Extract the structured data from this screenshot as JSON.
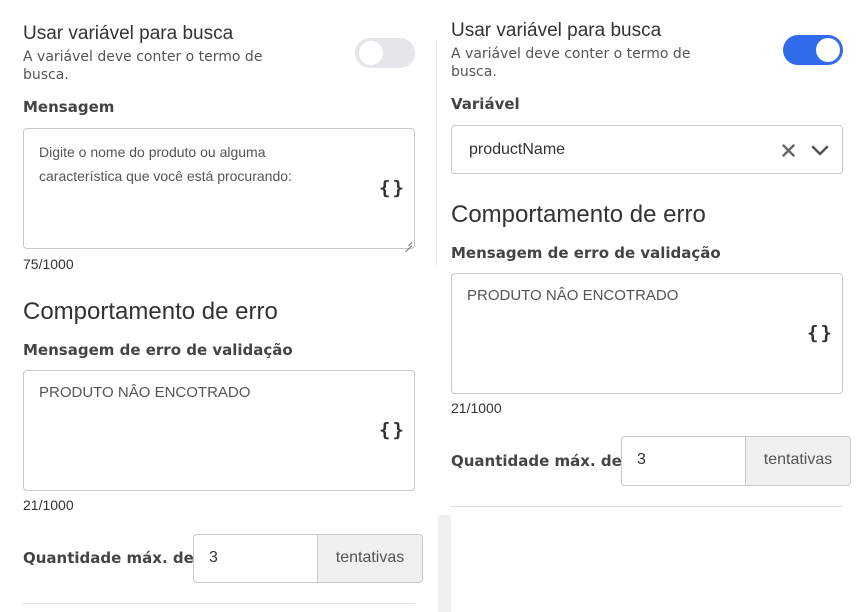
{
  "left": {
    "toggle": {
      "title": "Usar variável para busca",
      "description": "A variável deve conter o termo de busca.",
      "state": "off"
    },
    "message": {
      "label": "Mensagem",
      "value": "Digite o nome do produto ou alguma característica que você está procurando:",
      "counter": "75/1000",
      "icon": "curly-braces-icon"
    },
    "error": {
      "title": "Comportamento de erro",
      "label": "Mensagem de erro de validação",
      "value": "PRODUTO NÂO ENCOTRADO",
      "counter": "21/1000",
      "icon": "curly-braces-icon"
    },
    "quantity": {
      "label": "Quantidade máx. de:",
      "value": "3",
      "suffix": "tentativas"
    }
  },
  "right": {
    "toggle": {
      "title": "Usar variável para busca",
      "description": "A variável deve conter o termo de busca.",
      "state": "on"
    },
    "variable": {
      "label": "Variável",
      "value": "productName",
      "clear_icon": "close-icon",
      "dropdown_icon": "chevron-down-icon"
    },
    "error": {
      "title": "Comportamento de erro",
      "label": "Mensagem de erro de validação",
      "value": "PRODUTO NÂO ENCOTRADO",
      "counter": "21/1000",
      "icon": "curly-braces-icon"
    },
    "quantity": {
      "label": "Quantidade máx. de:",
      "value": "3",
      "suffix": "tentativas"
    }
  },
  "colors": {
    "toggle_on": "#2f6bea",
    "toggle_off": "#e4e6ea",
    "border": "#c9c9c9",
    "suffix_bg": "#f0f0f0"
  }
}
